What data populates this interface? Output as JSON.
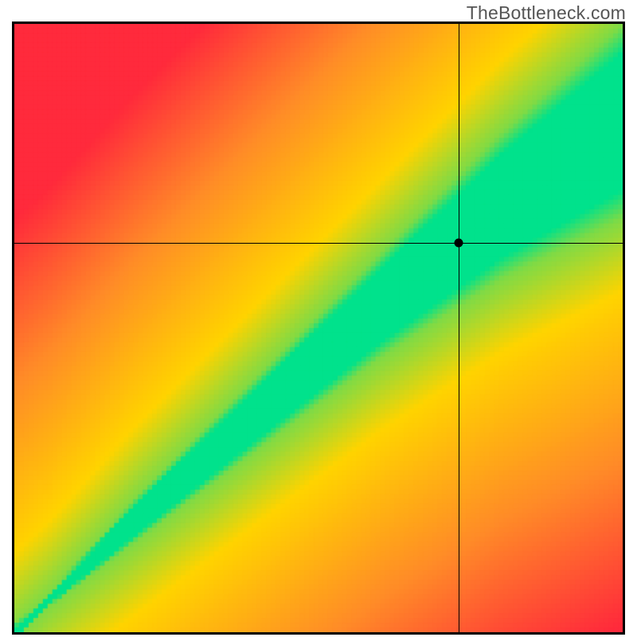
{
  "watermark": "TheBottleneck.com",
  "chart_data": {
    "type": "heatmap",
    "title": "",
    "xlabel": "",
    "ylabel": "",
    "xlim": [
      0,
      100
    ],
    "ylim": [
      0,
      100
    ],
    "crosshair": {
      "x": 73,
      "y": 64
    },
    "marker": {
      "x": 73,
      "y": 64
    },
    "legend": {
      "low_match": "red",
      "near_match": "yellow",
      "ideal_match": "green"
    },
    "optimal_band": {
      "description": "Green band from origin to top-right corner indicating balanced pairing; widens toward high end",
      "lower_curve": [
        {
          "x": 0,
          "y": 0
        },
        {
          "x": 20,
          "y": 15
        },
        {
          "x": 40,
          "y": 30
        },
        {
          "x": 60,
          "y": 45
        },
        {
          "x": 80,
          "y": 58
        },
        {
          "x": 100,
          "y": 68
        }
      ],
      "upper_curve": [
        {
          "x": 0,
          "y": 0
        },
        {
          "x": 20,
          "y": 22
        },
        {
          "x": 40,
          "y": 42
        },
        {
          "x": 60,
          "y": 62
        },
        {
          "x": 80,
          "y": 82
        },
        {
          "x": 100,
          "y": 100
        }
      ]
    },
    "gradient_field": {
      "description": "Red far from band → orange/yellow transition → green inside band",
      "colors": {
        "far": "#ff2a3c",
        "mid": "#ffd400",
        "ideal": "#00e28c"
      }
    }
  }
}
